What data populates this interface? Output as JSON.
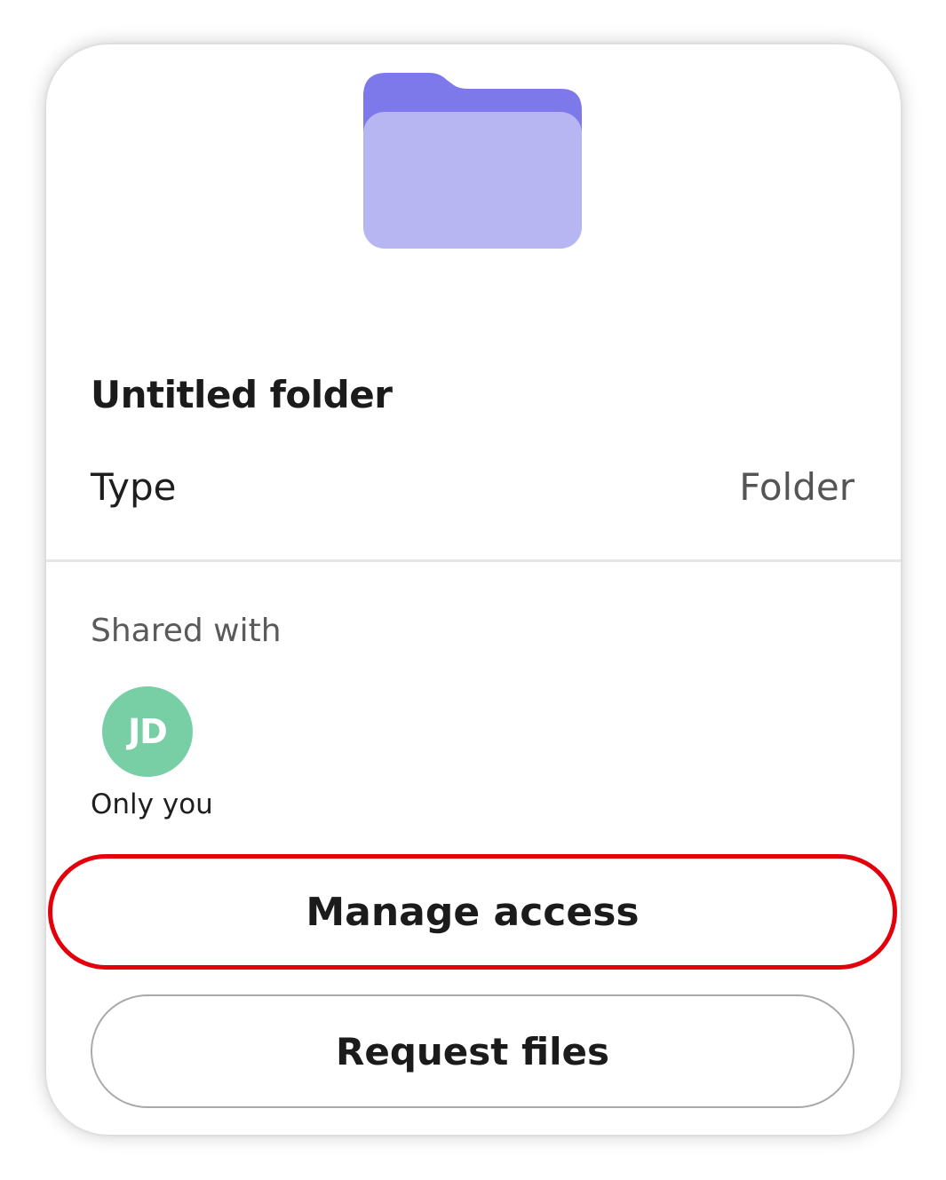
{
  "header": {
    "icon": "folder-icon",
    "title": "Untitled folder"
  },
  "details": {
    "type_label": "Type",
    "type_value": "Folder"
  },
  "sharing": {
    "label": "Shared with",
    "avatar_initials": "JD",
    "avatar_caption": "Only you"
  },
  "actions": {
    "manage_access_label": "Manage access",
    "request_files_label": "Request files"
  },
  "colors": {
    "folder_back": "#7d79eb",
    "folder_front": "#b7b5f2",
    "avatar": "#78cfa6",
    "highlight": "#e3000b"
  }
}
